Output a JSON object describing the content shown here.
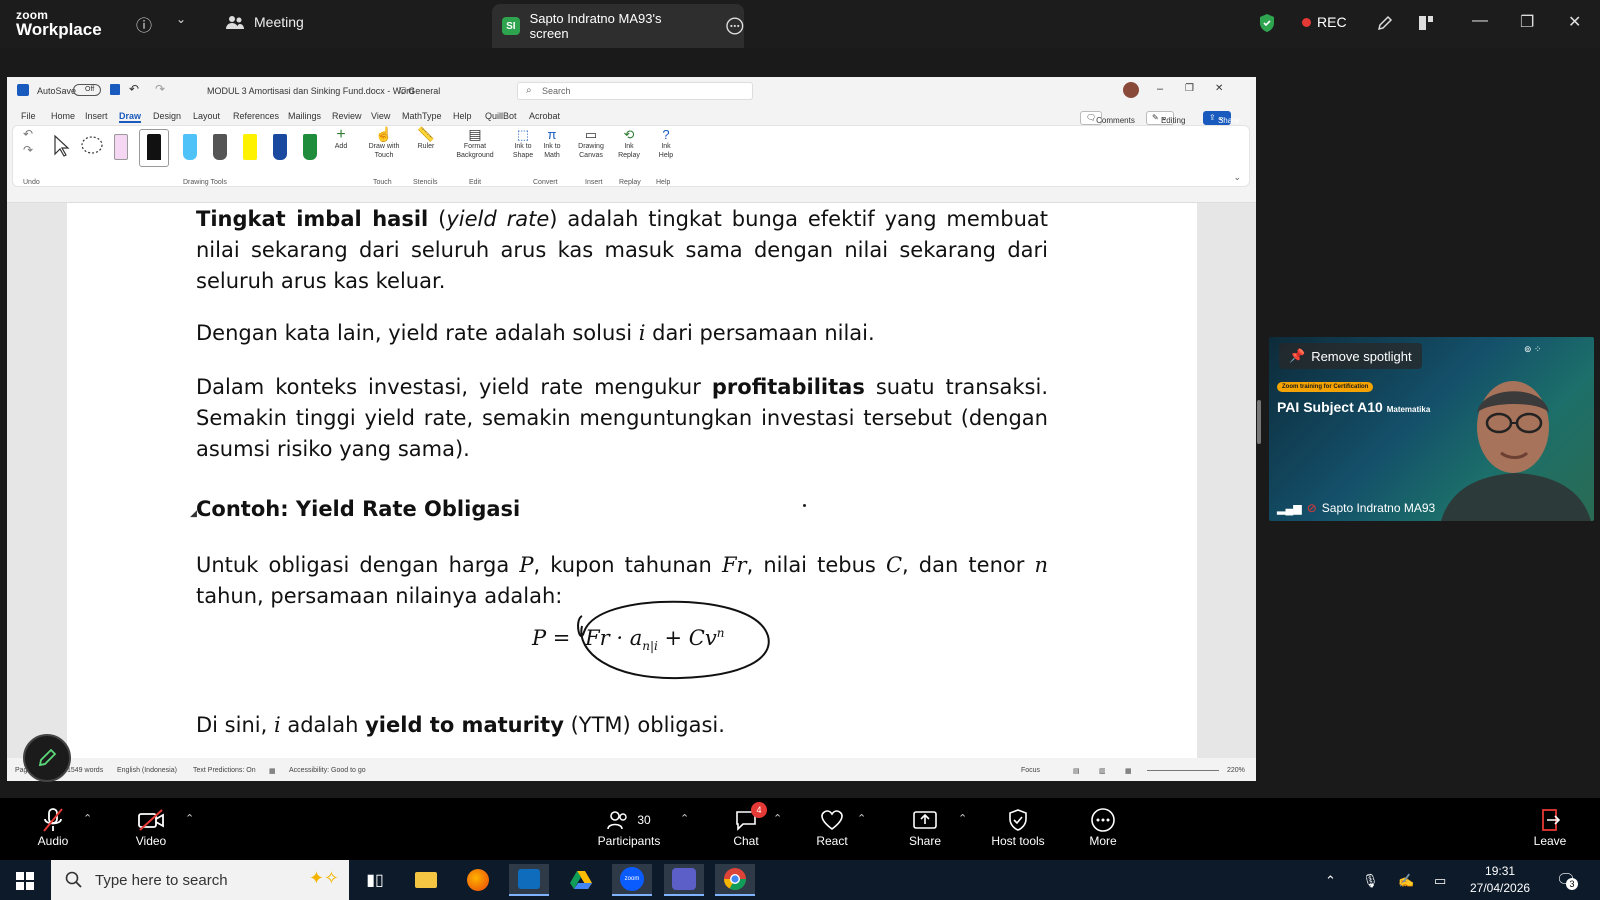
{
  "zoom": {
    "logo_line1": "zoom",
    "logo_line2": "Workplace",
    "meeting_tab": "Meeting",
    "screen_tab": "Sapto Indratno MA93's screen",
    "screen_badge": "SI",
    "rec_label": "REC",
    "accent_green": "#2ea44f",
    "rec_red": "#e53935"
  },
  "word": {
    "autosave_label": "AutoSave",
    "autosave_state": "Off",
    "file_title": "MODUL 3 Amortisasi dan Sinking Fund.docx",
    "app_name": "Word",
    "sensitivity": "General",
    "search_placeholder": "Search",
    "menus": [
      "File",
      "Home",
      "Insert",
      "Draw",
      "Design",
      "Layout",
      "References",
      "Mailings",
      "Review",
      "View",
      "MathType",
      "Help",
      "QuillBot",
      "Acrobat"
    ],
    "active_menu": "Draw",
    "comments_label": "Comments",
    "editing_label": "Editing",
    "share_label": "Share",
    "ribbon": {
      "undo_group": "Undo",
      "drawing_tools_group": "Drawing Tools",
      "add_label": "Add",
      "draw_touch_l1": "Draw with",
      "draw_touch_l2": "Touch",
      "ruler_label": "Ruler",
      "format_bg_l1": "Format",
      "format_bg_l2": "Background",
      "ink_shape_l1": "Ink to",
      "ink_shape_l2": "Shape",
      "ink_math_l1": "Ink to",
      "ink_math_l2": "Math",
      "drawing_canvas_l1": "Drawing",
      "drawing_canvas_l2": "Canvas",
      "ink_replay_l1": "Ink",
      "ink_replay_l2": "Replay",
      "ink_help_l1": "Ink",
      "ink_help_l2": "Help",
      "groups": {
        "touch": "Touch",
        "stencils": "Stencils",
        "edit": "Edit",
        "convert": "Convert",
        "insert": "Insert",
        "replay": "Replay",
        "help": "Help"
      }
    },
    "doc": {
      "p1_bold": "Tingkat imbal hasil",
      "p1_italic": "yield rate",
      "p1_rest": ") adalah tingkat bunga efektif yang membuat nilai sekarang dari seluruh arus kas masuk sama dengan nilai sekarang dari seluruh arus kas keluar.",
      "p2_a": "Dengan kata lain, yield rate adalah solusi ",
      "p2_var": "i",
      "p2_b": " dari persamaan nilai.",
      "p3_a": "Dalam konteks investasi, yield rate mengukur ",
      "p3_bold": "profitabilitas",
      "p3_b": " suatu transaksi. Semakin tinggi yield rate, semakin menguntungkan investasi tersebut (dengan asumsi risiko yang sama).",
      "heading": "Contoh: Yield Rate Obligasi",
      "p4_a": "Untuk obligasi dengan harga ",
      "p4_P": "P",
      "p4_b": ", kupon tahunan ",
      "p4_Fr": "Fr",
      "p4_c": ", nilai tebus ",
      "p4_C": "C",
      "p4_d": ", dan tenor ",
      "p4_n": "n",
      "p4_e": " tahun, persamaan nilainya adalah:",
      "formula_lhs": "P =",
      "formula_rhs_a": "Fr · a",
      "formula_sub": "n|i",
      "formula_rhs_b": " + Cv",
      "formula_sup": "n",
      "p5_a": "Di sini, ",
      "p5_var": "i",
      "p5_b": " adalah ",
      "p5_bold": "yield to maturity",
      "p5_c": " (YTM) obligasi."
    },
    "status": {
      "page": "Pag",
      "words": "1549 words",
      "language": "English (Indonesia)",
      "predictions": "Text Predictions: On",
      "accessibility": "Accessibility: Good to go",
      "focus": "Focus",
      "zoom": "220%"
    }
  },
  "video": {
    "remove_spotlight": "Remove spotlight",
    "cert_badge": "Zoom training for Certification",
    "title_main": "PAI Subject A10",
    "title_sub": "Matematika",
    "participant_name": "Sapto Indratno MA93"
  },
  "toolbar": {
    "audio": "Audio",
    "video": "Video",
    "participants": "Participants",
    "participants_count": "30",
    "chat": "Chat",
    "chat_badge": "4",
    "react": "React",
    "share": "Share",
    "host_tools": "Host tools",
    "more": "More",
    "leave": "Leave"
  },
  "taskbar": {
    "search_placeholder": "Type here to search",
    "time": "19:31",
    "date": "27/04/2026",
    "notif_count": "3"
  }
}
